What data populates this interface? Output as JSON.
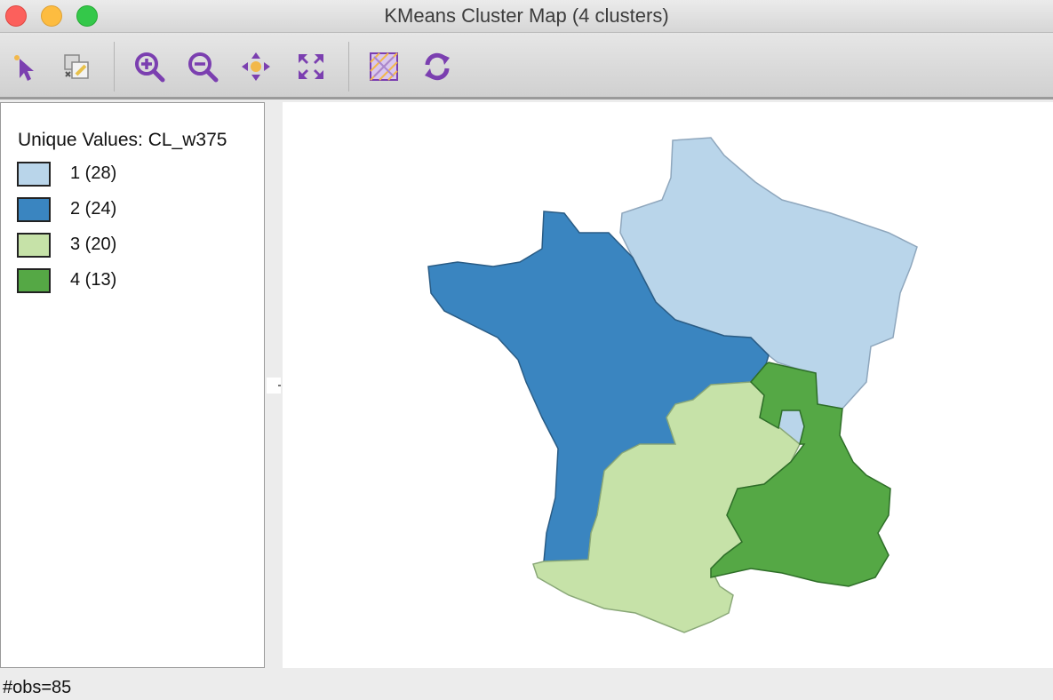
{
  "window": {
    "title": "KMeans Cluster Map (4 clusters)"
  },
  "toolbar": {
    "buttons": [
      {
        "name": "select-pointer",
        "icon": "pointer-icon"
      },
      {
        "name": "selection-shape",
        "icon": "selection-shape-icon"
      },
      {
        "name": "zoom-in",
        "icon": "zoom-in-icon"
      },
      {
        "name": "zoom-out",
        "icon": "zoom-out-icon"
      },
      {
        "name": "pan",
        "icon": "pan-icon"
      },
      {
        "name": "fit-to-window",
        "icon": "fit-icon"
      },
      {
        "name": "toggle-layer",
        "icon": "layer-icon"
      },
      {
        "name": "refresh",
        "icon": "refresh-icon"
      }
    ],
    "accent_color": "#7b3fb0"
  },
  "legend": {
    "title": "Unique Values: CL_w375",
    "items": [
      {
        "label": "1 (28)",
        "color": "#b9d5ea"
      },
      {
        "label": "2 (24)",
        "color": "#3a85c0"
      },
      {
        "label": "3 (20)",
        "color": "#c6e2a8"
      },
      {
        "label": "4 (13)",
        "color": "#55a845"
      }
    ]
  },
  "map": {
    "outline_colors": {
      "cluster1": "#8fa7bd",
      "cluster2": "#2a5c85",
      "cluster3": "#8aa878",
      "cluster4": "#2e6e28"
    }
  },
  "status": {
    "text": "#obs=85"
  }
}
